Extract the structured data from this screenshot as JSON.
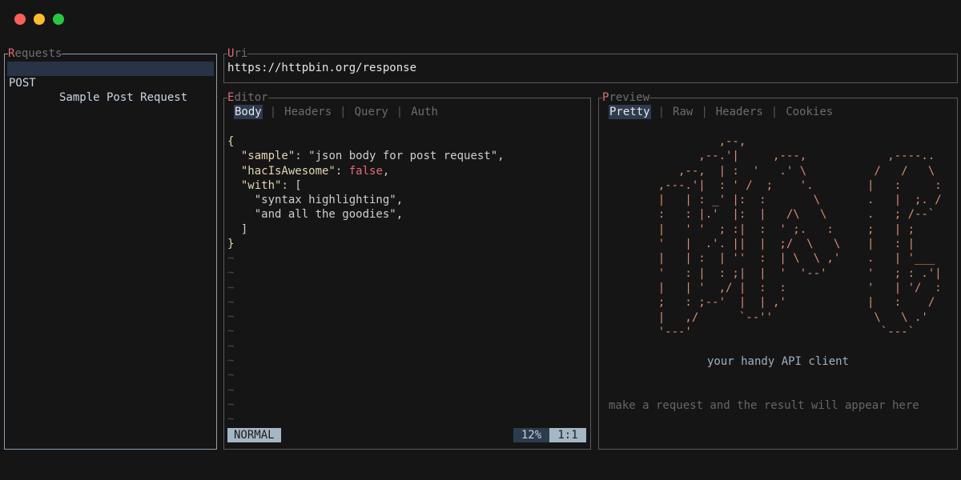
{
  "window": {
    "buttons": [
      "close",
      "minimize",
      "maximize"
    ]
  },
  "requests": {
    "title_hotkey": "R",
    "title_rest": "equests",
    "items": [
      {
        "method": "POST",
        "name": "Sample Post Request"
      }
    ]
  },
  "uri": {
    "title_hotkey": "U",
    "title_rest": "ri",
    "value": "https://httpbin.org/response"
  },
  "editor": {
    "title_hotkey": "E",
    "title_rest": "ditor",
    "tabs": [
      "Body",
      "Headers",
      "Query",
      "Auth"
    ],
    "active_tab": "Body",
    "code_lines": [
      "{",
      "  \"sample\": \"json body for post request\",",
      "  \"hacIsAwesome\": false,",
      "  \"with\": [",
      "    \"syntax highlighting\",",
      "    \"and all the goodies\",",
      "  ]",
      "}"
    ],
    "empty_line_marker": "~",
    "empty_line_count": 12,
    "mode": "NORMAL",
    "scroll_percent": "12%",
    "cursor_position": "1:1"
  },
  "preview": {
    "title_hotkey": "P",
    "title_rest": "review",
    "tabs": [
      "Pretty",
      "Raw",
      "Headers",
      "Cookies"
    ],
    "active_tab": "Pretty",
    "ascii_logo": "             ,--,\n          ,--.'|     ,---,            ,----..\n       ,--,  | :  '   .' \\          /   /   \\\n    ,---.'|  : ' /  ;    '.        |   :     :\n    |   | : _' |:  :       \\       .   |  ;. /\n    :   : |.'  |:  |   /\\   \\      .   ; /--`\n    |   ' '  ; :|  :  ' ;.   :     ;   | ;\n    '   |  .'. ||  |  ;/  \\   \\    |   : |\n    |   | :  | ''  :  | \\  \\ ,'    .   | '___\n    '   : |  : ;|  |  '  '--'      '   ; : .'|\n    |   | '  ,/ |  :  :            '   | '/  :\n    ;   : ;--'  |  | ,'            |   :    /\n    |   ,/      `--''               \\   \\ .'\n    '---'                            `---`",
    "tagline": "your handy API client",
    "hint": "make a request and the result will appear here"
  }
}
